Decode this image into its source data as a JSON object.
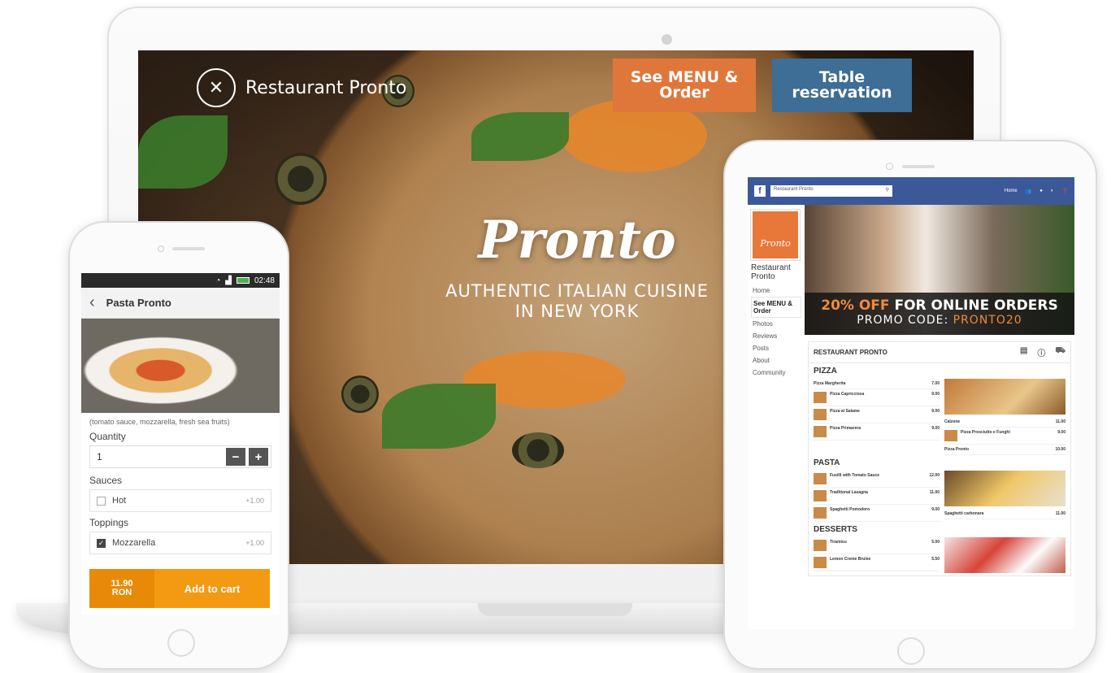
{
  "laptop": {
    "brand_name": "Restaurant Pronto",
    "menu_button": "See MENU &\nOrder",
    "table_button": "Table\nreservation",
    "hero_title": "Pronto",
    "hero_subtitle_line1": "AUTHENTIC ITALIAN CUISINE",
    "hero_subtitle_line2": "IN NEW YORK",
    "colors": {
      "menu_button": "#e0773a",
      "table_button": "#3e6d95"
    }
  },
  "phone": {
    "status_time": "02:48",
    "header_title": "Pasta Pronto",
    "description": "(tomato sauce, mozzarella, fresh sea fruits)",
    "quantity_label": "Quantity",
    "quantity_value": "1",
    "minus": "−",
    "plus": "+",
    "sauces_label": "Sauces",
    "sauce_option": {
      "label": "Hot",
      "price": "+1.00",
      "checked": false
    },
    "toppings_label": "Toppings",
    "topping_option": {
      "label": "Mozzarella",
      "price": "+1.00",
      "checked": true
    },
    "cart_price": "11.90\nRON",
    "cart_label": "Add to cart",
    "colors": {
      "cart": "#f39a12"
    }
  },
  "tablet": {
    "fb_search": "Restaurant Pronto",
    "fb_home": "Home",
    "page_name": "Restaurant Pronto",
    "avatar_text": "Pronto",
    "nav": [
      "Home",
      "See MENU & Order",
      "Photos",
      "Reviews",
      "Posts",
      "About",
      "Community"
    ],
    "promo_discount": "20% OFF",
    "promo_rest": " FOR ONLINE ORDERS",
    "promo_code_label": "PROMO CODE: ",
    "promo_code": "PRONTO20",
    "menu_title": "RESTAURANT PRONTO",
    "categories": {
      "pizza": "PIZZA",
      "pasta": "PASTA",
      "desserts": "DESSERTS"
    },
    "pizza_items": [
      {
        "name": "Pizza Margherita",
        "price": "7.00"
      },
      {
        "name": "Pizza Capricciosa",
        "price": "9.00"
      },
      {
        "name": "Pizza al Salame",
        "price": "9.00"
      },
      {
        "name": "Pizza Primavera",
        "price": "9.00"
      }
    ],
    "pizza_right_items": [
      {
        "name": "Calzone",
        "price": "11.00"
      },
      {
        "name": "Pizza Prosciutto e Funghi",
        "price": "9.00"
      },
      {
        "name": "Pizza Pronto",
        "price": "10.00"
      }
    ],
    "pasta_items": [
      {
        "name": "Fusilli with Tomato Sauce",
        "price": "12.00"
      },
      {
        "name": "Traditional Lasagna",
        "price": "11.00"
      },
      {
        "name": "Spaghetti Pomodoro",
        "price": "9.00"
      }
    ],
    "pasta_right_items": [
      {
        "name": "Spaghetti carbonara",
        "price": "11.00"
      }
    ],
    "dessert_items": [
      {
        "name": "Tiramisu",
        "price": "5.00"
      },
      {
        "name": "Lemon Creme Brulee",
        "price": "5.50"
      }
    ],
    "colors": {
      "fb_bar": "#3b5998",
      "accent": "#f08a3a"
    }
  }
}
